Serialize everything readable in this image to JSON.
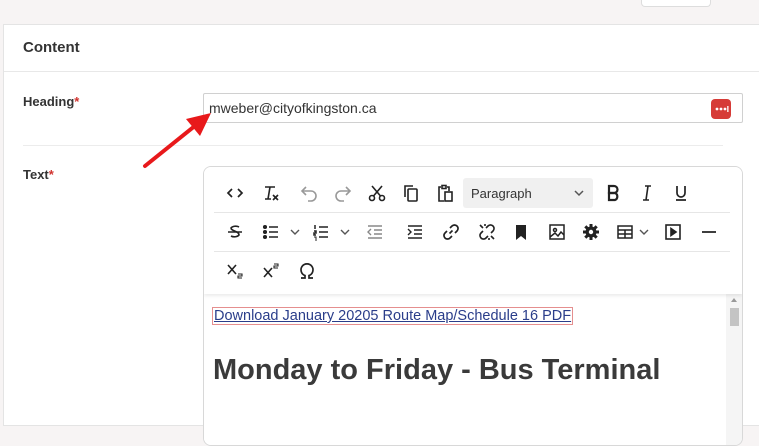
{
  "panel": {
    "title": "Content"
  },
  "heading_field": {
    "label": "Heading",
    "required_mark": "*",
    "value": "mweber@cityofkingston.ca"
  },
  "text_field": {
    "label": "Text",
    "required_mark": "*"
  },
  "editor": {
    "format_select": "Paragraph",
    "content": {
      "link_text": "Download January 20205 Route Map/Schedule 16 PDF",
      "heading": "Monday to Friday - Bus Terminal"
    },
    "toolbar_icons": [
      "source-code",
      "clear-formatting",
      "undo",
      "redo",
      "cut",
      "copy",
      "paste",
      "bold",
      "italic",
      "underline",
      "strikethrough",
      "bullet-list",
      "numbered-list",
      "outdent",
      "indent",
      "link",
      "unlink",
      "bookmark",
      "image",
      "settings",
      "table",
      "media",
      "horizontal-line",
      "subscript",
      "superscript",
      "special-character"
    ]
  },
  "colors": {
    "required": "#d0312d",
    "password_manager_icon": "#d63b37",
    "annotation_arrow": "#e8191b"
  }
}
